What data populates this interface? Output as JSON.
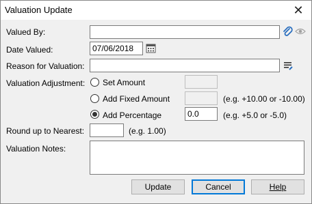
{
  "window": {
    "title": "Valuation Update"
  },
  "fields": {
    "valued_by": {
      "label": "Valued By:",
      "value": ""
    },
    "date_valued": {
      "label": "Date Valued:",
      "value": "07/06/2018"
    },
    "reason": {
      "label": "Reason for Valuation:",
      "value": ""
    },
    "adjustment": {
      "label": "Valuation Adjustment:",
      "options": [
        {
          "label": "Set Amount",
          "selected": false,
          "value": "",
          "hint": ""
        },
        {
          "label": "Add Fixed Amount",
          "selected": false,
          "value": "",
          "hint": "(e.g. +10.00 or -10.00)"
        },
        {
          "label": "Add Percentage",
          "selected": true,
          "value": "0.0",
          "hint": "(e.g. +5.0 or -5.0)"
        }
      ]
    },
    "round_up": {
      "label": "Round up to Nearest:",
      "value": "",
      "hint": "(e.g. 1.00)"
    },
    "notes": {
      "label": "Valuation Notes:",
      "value": ""
    }
  },
  "buttons": {
    "update": "Update",
    "cancel": "Cancel",
    "help": "Help"
  },
  "colors": {
    "accent": "#0078d7",
    "paperclip": "#2a6fbf"
  }
}
